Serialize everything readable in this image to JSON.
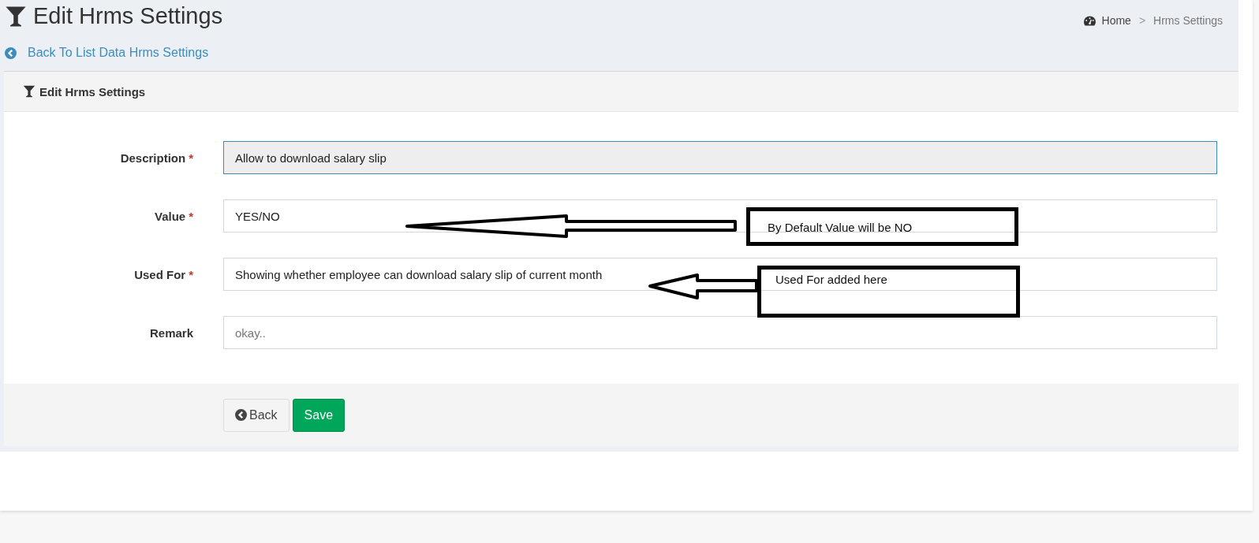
{
  "page": {
    "title": "Edit Hrms Settings",
    "back_link": "Back To List Data Hrms Settings"
  },
  "breadcrumb": [
    {
      "label": "Home",
      "kind": "home"
    },
    {
      "label": "Hrms Settings",
      "kind": "current"
    }
  ],
  "separator": ">",
  "card": {
    "title": "Edit Hrms Settings"
  },
  "fields": [
    {
      "label": "Description",
      "mark": "*",
      "value": "Allow to download salary slip",
      "disabled": true
    },
    {
      "label": "Value",
      "mark": "*",
      "value": "YES/NO",
      "disabled": false
    },
    {
      "label": "Used For",
      "mark": "*",
      "value": "Showing whether employee can download salary slip of current month",
      "disabled": false
    },
    {
      "label": "Remark",
      "placeholder": "okay..",
      "disabled": false
    }
  ],
  "buttons": [
    {
      "label": "Back",
      "kind": "back"
    },
    {
      "label": "Save",
      "kind": "save"
    }
  ],
  "annotations": [
    {
      "text": "By Default Value will be NO",
      "kind": "long"
    },
    {
      "text": "Used For added here",
      "kind": "short"
    }
  ]
}
